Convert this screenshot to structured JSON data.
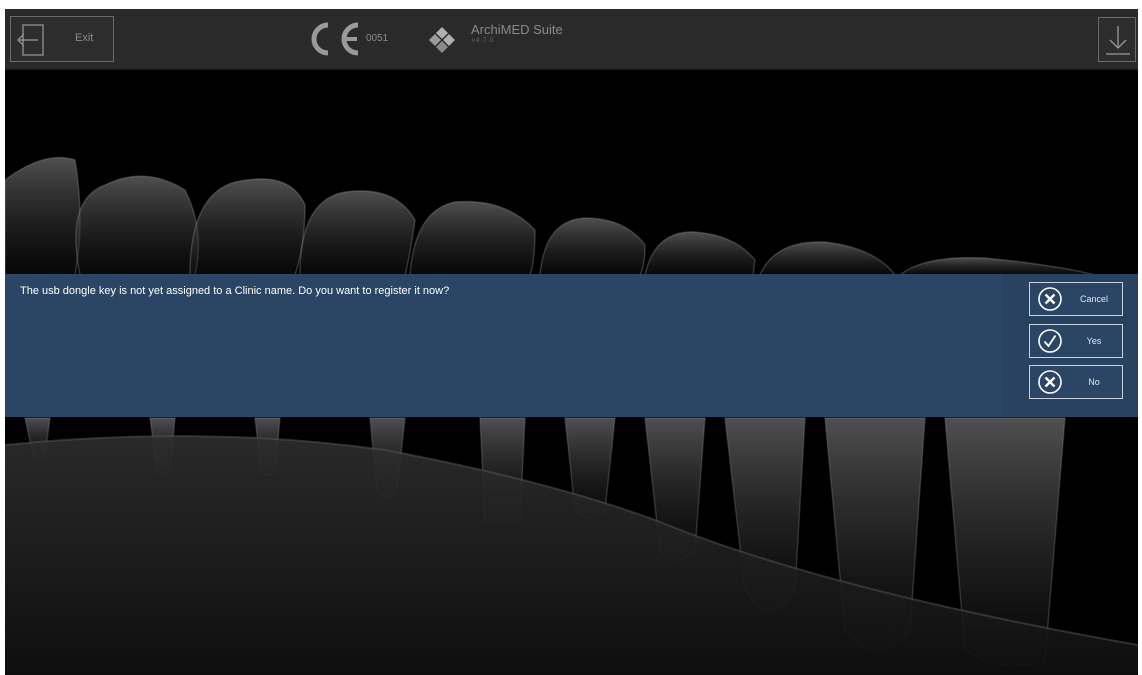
{
  "topbar": {
    "exit_label": "Exit",
    "ce_number": "0051",
    "app_name": "ArchiMED Suite",
    "app_version": "v4.7.0"
  },
  "dialog": {
    "message": "The usb dongle key is not yet assigned to a Clinic name. Do you want to register it now?",
    "buttons": [
      {
        "label": "Cancel",
        "icon": "circle-x-icon"
      },
      {
        "label": "Yes",
        "icon": "circle-check-icon"
      },
      {
        "label": "No",
        "icon": "circle-x-icon"
      }
    ]
  },
  "colors": {
    "topbar": "#2a2a2a",
    "dialog": "#2b4664",
    "dialog_panel": "#29425f",
    "background": "#000000"
  }
}
